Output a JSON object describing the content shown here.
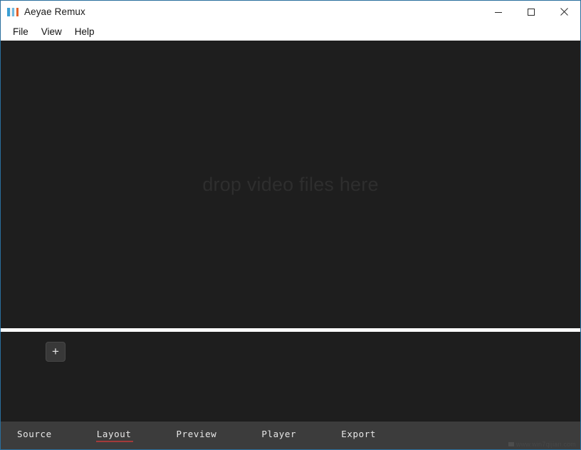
{
  "window": {
    "title": "Aeyae Remux",
    "icon": "app-icon",
    "controls": {
      "minimize": "Minimize",
      "maximize": "Maximize",
      "close": "Close"
    },
    "accent_border_color": "#2a6f9e"
  },
  "menubar": {
    "items": [
      {
        "label": "File"
      },
      {
        "label": "View"
      },
      {
        "label": "Help"
      }
    ]
  },
  "video_pane": {
    "drop_hint": "drop video files here",
    "background_color": "#1e1e1e",
    "hint_color": "#2e2e2e"
  },
  "splitter": {
    "color": "#ffffff"
  },
  "layout_pane": {
    "add_button_label": "+",
    "background_color": "#1e1e1e"
  },
  "tabbar": {
    "background_color": "#3c3c3c",
    "selected_underline_color": "#a33a3a",
    "selected": "Layout",
    "tabs": [
      {
        "label": "Source",
        "selected": false
      },
      {
        "label": "Layout",
        "selected": true
      },
      {
        "label": "Preview",
        "selected": false
      },
      {
        "label": "Player",
        "selected": false
      },
      {
        "label": "Export",
        "selected": false
      }
    ],
    "watermark": "www.win7qijian.com"
  }
}
